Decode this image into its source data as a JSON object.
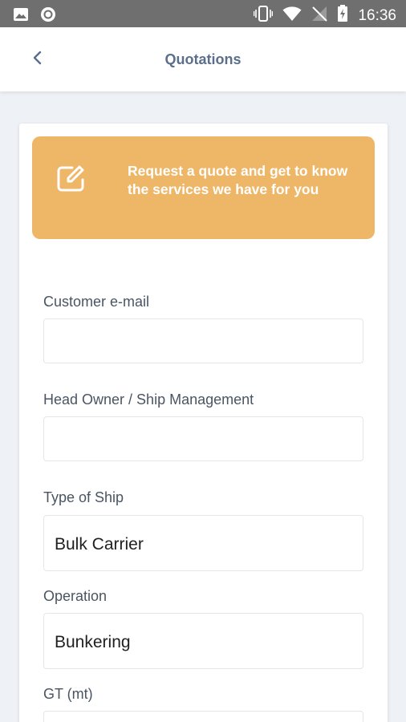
{
  "status_bar": {
    "time": "16:36",
    "left_icons": [
      "image-icon",
      "circle-icon"
    ],
    "right_icons": [
      "vibrate-icon",
      "wifi-icon",
      "no-signal-icon",
      "battery-charging-icon"
    ]
  },
  "app_bar": {
    "title": "Quotations",
    "back_icon": "chevron-left-icon"
  },
  "banner": {
    "icon": "edit-icon",
    "text": "Request a quote and get to know the services we have for you",
    "background": "#eeb667"
  },
  "form": {
    "customer_email": {
      "label": "Customer e-mail",
      "value": ""
    },
    "head_owner": {
      "label": "Head Owner / Ship Management",
      "value": ""
    },
    "type_of_ship": {
      "label": "Type of Ship",
      "value": "Bulk Carrier"
    },
    "operation": {
      "label": "Operation",
      "value": "Bunkering"
    },
    "gt": {
      "label": "GT (mt)",
      "value": ""
    }
  },
  "colors": {
    "status_bar": "#6f6f6f",
    "title": "#5b6f8b",
    "page_background": "#eef1f6"
  }
}
